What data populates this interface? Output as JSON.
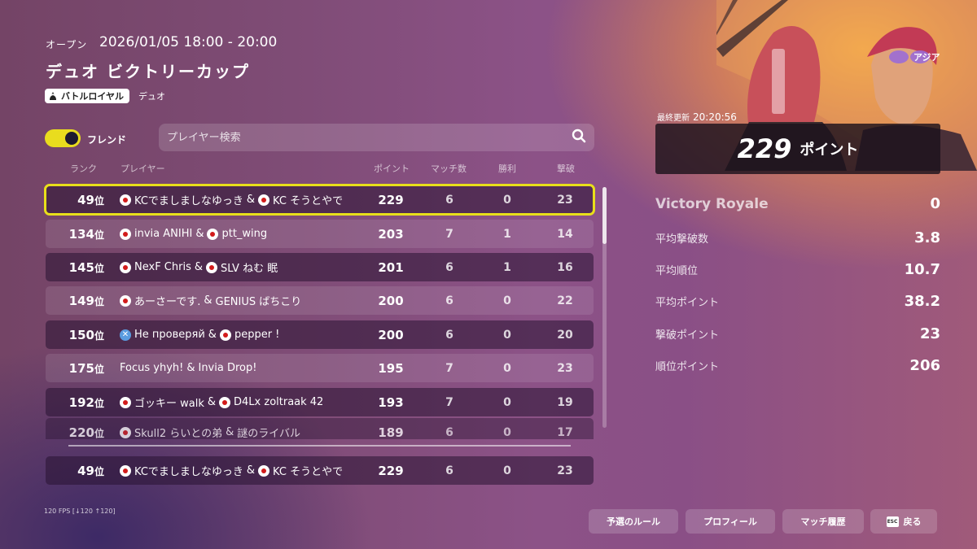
{
  "header": {
    "status_label": "オープン",
    "datetime": "2026/01/05 18:00 - 20:00",
    "title": "デュオ ビクトリーカップ",
    "mode_label": "バトルロイヤル",
    "mode_sub": "デュオ"
  },
  "filter": {
    "friends_label": "フレンド",
    "friends_on": true,
    "search_placeholder": "プレイヤー検索"
  },
  "table": {
    "columns": {
      "rank": "ランク",
      "player": "プレイヤー",
      "points": "ポイント",
      "matches": "マッチ数",
      "wins": "勝利",
      "elims": "撃破"
    },
    "rows": [
      {
        "rank": "49",
        "suffix": "位",
        "p1": "KCでましましなゆっき",
        "p1_flag": "jp",
        "p2": "KC そうとやで",
        "p2_flag": "jp",
        "points": "229",
        "matches": "6",
        "wins": "0",
        "elims": "23"
      },
      {
        "rank": "134",
        "suffix": "位",
        "p1": "invia ANIHI",
        "p1_flag": "jp",
        "p2": "ptt_wing",
        "p2_flag": "jp",
        "points": "203",
        "matches": "7",
        "wins": "1",
        "elims": "14"
      },
      {
        "rank": "145",
        "suffix": "位",
        "p1": "NexF Chris",
        "p1_flag": "jp",
        "p2": "SLV ねむ 眠",
        "p2_flag": "jp",
        "points": "201",
        "matches": "6",
        "wins": "1",
        "elims": "16"
      },
      {
        "rank": "149",
        "suffix": "位",
        "p1": "あーさーです.",
        "p1_flag": "jp",
        "p2": "GENIUS ばちこり",
        "p2_flag": "",
        "points": "200",
        "matches": "6",
        "wins": "0",
        "elims": "22"
      },
      {
        "rank": "150",
        "suffix": "位",
        "p1": "Не проверяй",
        "p1_flag": "x",
        "p2": "pepper !",
        "p2_flag": "jp",
        "points": "200",
        "matches": "6",
        "wins": "0",
        "elims": "20"
      },
      {
        "rank": "175",
        "suffix": "位",
        "p1": "Focus yhyh!",
        "p1_flag": "",
        "p2": "Invia Drop!",
        "p2_flag": "",
        "points": "195",
        "matches": "7",
        "wins": "0",
        "elims": "23"
      },
      {
        "rank": "192",
        "suffix": "位",
        "p1": "ゴッキー walk",
        "p1_flag": "jp",
        "p2": "D4Lx zoltraak 42",
        "p2_flag": "jp",
        "points": "193",
        "matches": "7",
        "wins": "0",
        "elims": "19"
      },
      {
        "rank": "220",
        "suffix": "位",
        "p1": "Skull2 らいとの弟",
        "p1_flag": "jp",
        "p2": "謎のライバル",
        "p2_flag": "",
        "points": "189",
        "matches": "6",
        "wins": "0",
        "elims": "17"
      }
    ],
    "pinned": {
      "rank": "49",
      "suffix": "位",
      "p1": "KCでましましなゆっき",
      "p2": "KC そうとやで",
      "points": "229",
      "matches": "6",
      "wins": "0",
      "elims": "23"
    }
  },
  "summary": {
    "region": "アジア",
    "updated_label": "最終更新",
    "updated_time": "20:20:56",
    "points": "229",
    "points_unit": "ポイント",
    "stats": [
      {
        "label": "Victory Royale",
        "value": "0"
      },
      {
        "label": "平均撃破数",
        "value": "3.8"
      },
      {
        "label": "平均順位",
        "value": "10.7"
      },
      {
        "label": "平均ポイント",
        "value": "38.2"
      },
      {
        "label": "撃破ポイント",
        "value": "23"
      },
      {
        "label": "順位ポイント",
        "value": "206"
      }
    ]
  },
  "footer": {
    "fps": "120 FPS [↓120 ↑120]",
    "buttons": {
      "rules": "予選のルール",
      "profile": "プロフィール",
      "history": "マッチ履歴",
      "back": "戻る",
      "esc": "ESC"
    }
  },
  "colors": {
    "accent": "#e8df1a",
    "row_dark": "#3a1f3f",
    "panel": "#1c121c"
  }
}
